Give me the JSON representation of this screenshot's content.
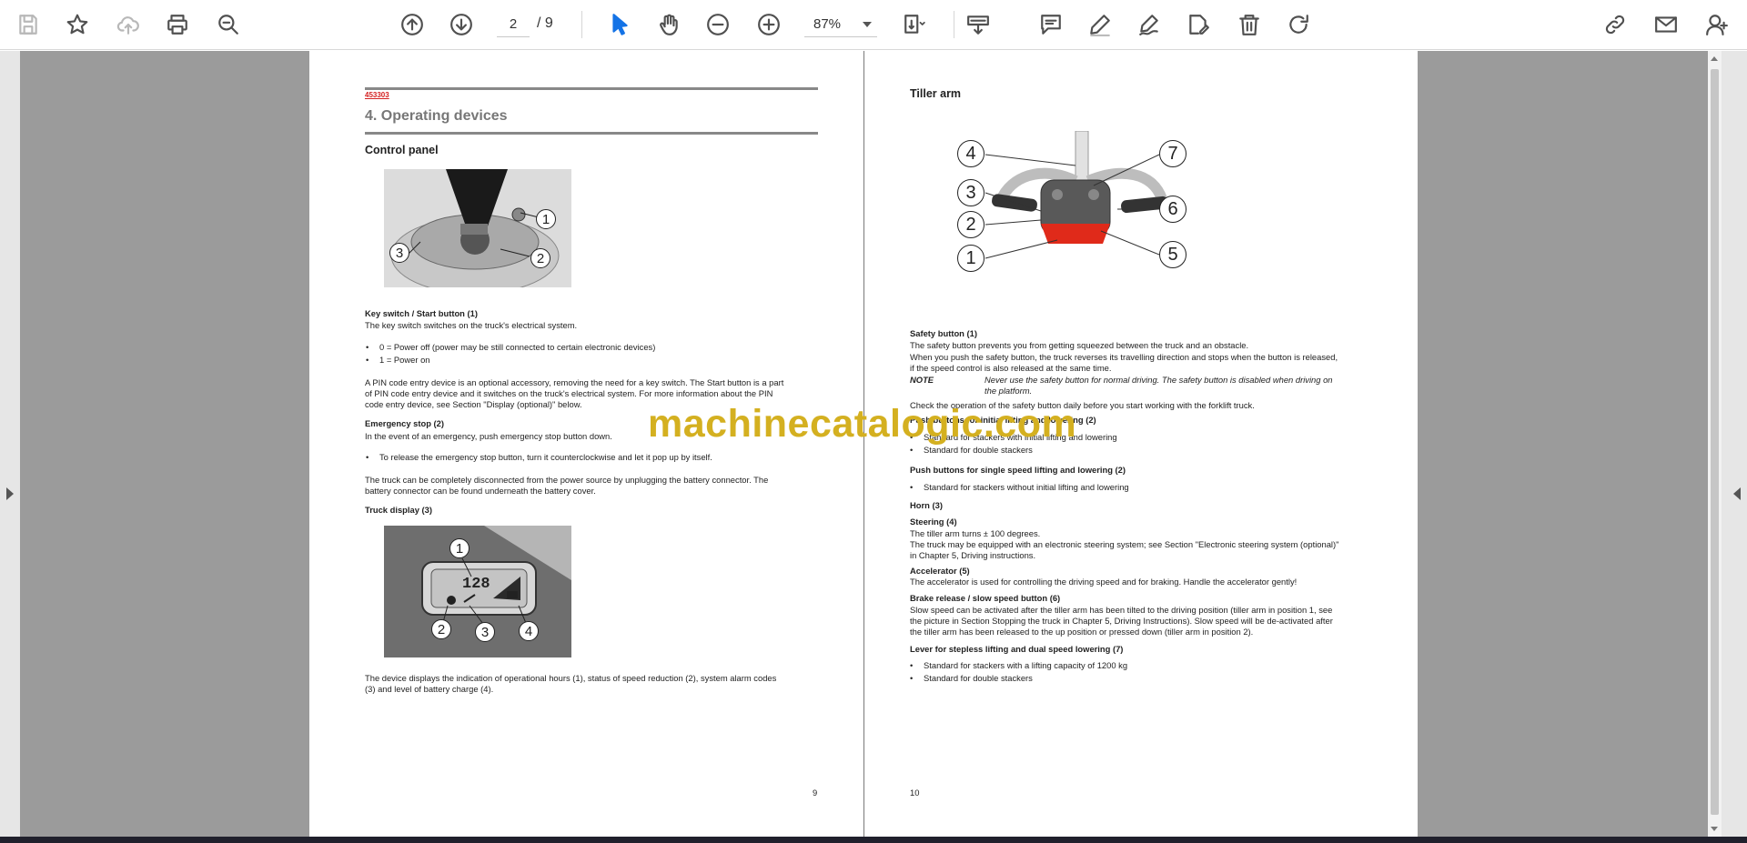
{
  "toolbar": {
    "page_current": "2",
    "page_total": "/ 9",
    "zoom": "87%"
  },
  "left_page": {
    "doc_code": "453303",
    "section_title": "4.  Operating devices",
    "subtitle": "Control panel",
    "key_switch_heading": "Key switch / Start button (1)",
    "key_switch_text": "The key switch switches on the truck's electrical system.",
    "key_bullets": [
      "0 = Power off (power may be still connected to certain electronic devices)",
      "1 = Power on"
    ],
    "pin_text": [
      "A PIN code entry device is an optional accessory, removing the need for a key switch. The Start button is a part",
      "of PIN code entry device and it switches on the truck's electrical system. For more information about the PIN",
      "code entry device, see Section \"Display (optional)\" below."
    ],
    "emergency_heading": "Emergency stop (2)",
    "emergency_text": "In the event of an emergency, push emergency stop button down.",
    "emergency_bullet": "To release the emergency stop button, turn it counterclockwise and let it pop up by itself.",
    "disconnect_text": [
      "The truck can be completely disconnected from the power source by unplugging the battery connector. The",
      "battery connector can be found underneath the battery cover."
    ],
    "display_heading": "Truck display (3)",
    "display_reading": "128",
    "display_text": [
      "The device displays the indication of operational hours (1), status of speed reduction (2), system alarm codes",
      "(3) and level of battery charge (4)."
    ],
    "page_number": "9",
    "callouts_panel": [
      "1",
      "2",
      "3"
    ],
    "callouts_display": [
      "1",
      "2",
      "3",
      "4"
    ]
  },
  "right_page": {
    "title": "Tiller arm",
    "callouts_tiller": [
      "1",
      "2",
      "3",
      "4",
      "5",
      "6",
      "7"
    ],
    "safety_heading": "Safety button (1)",
    "safety_text": [
      "The safety button prevents you from getting squeezed between the truck and an obstacle.",
      "When you push the safety button, the truck reverses its travelling direction and stops when the button is released,",
      "if the speed control is also released at the same time."
    ],
    "note_label": "NOTE",
    "note_text": [
      "Never use the safety button for normal driving. The safety button is disabled when driving on",
      "the platform."
    ],
    "check_text": "Check the operation of the safety button daily before you start working with the forklift truck.",
    "push_heading": "Push buttons for initial lifting and lowering (2)",
    "push_bullets": [
      "Standard for stackers with initial lifting and lowering",
      "Standard for double stackers"
    ],
    "single_heading": "Push buttons for single speed lifting and lowering (2)",
    "single_bullet": "Standard for stackers without initial lifting and lowering",
    "horn_heading": "Horn (3)",
    "steering_heading": "Steering (4)",
    "steering_text": [
      "The tiller arm turns ± 100 degrees.",
      "The truck may be equipped with an electronic steering system; see Section \"Electronic steering system (optional)\"",
      "in Chapter 5, Driving instructions."
    ],
    "accel_heading": "Accelerator (5)",
    "accel_text": "The accelerator is used for controlling the driving speed and for braking. Handle the accelerator gently!",
    "brake_heading": "Brake release / slow speed button (6)",
    "brake_text": [
      "Slow speed can be activated after the tiller arm has been tilted to the driving position (tiller arm in position 1, see",
      "the picture in Section Stopping the truck in Chapter 5, Driving Instructions). Slow speed will be de-activated after",
      "the tiller arm has been released to the up position or pressed down (tiller arm in position 2)."
    ],
    "lever_heading": "Lever for stepless lifting and dual speed lowering (7)",
    "lever_bullets": [
      "Standard for stackers with a lifting capacity of 1200 kg",
      "Standard for double stackers"
    ],
    "page_number": "10"
  },
  "watermark": "machinecatalogic.com",
  "bullet_char": "•",
  "colors": {
    "accent": "#1473e6",
    "viewer_bg": "#9b9b9b",
    "doc_code": "#d42020",
    "watermark": "#d4b020",
    "tiller_red": "#e02a1a"
  }
}
